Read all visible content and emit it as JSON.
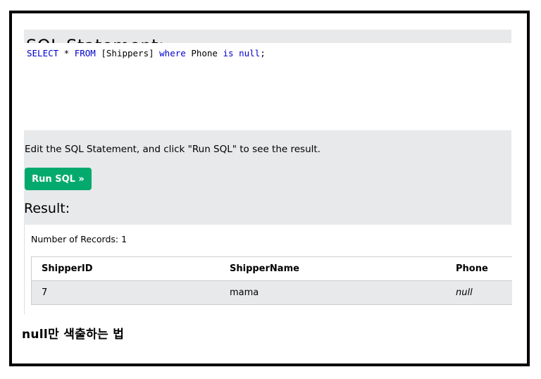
{
  "page": {
    "heading_cut": "SQL Statement:",
    "sql": {
      "select_kw": "SELECT",
      "star": " * ",
      "from_kw": "FROM",
      "table": " [Shippers] ",
      "where_kw": "where",
      "column": " Phone ",
      "is_kw": "is",
      "space": " ",
      "null_kw": "null",
      "end": ";"
    },
    "hint": "Edit the SQL Statement, and click \"Run SQL\" to see the result.",
    "run_button": "Run SQL »",
    "result_heading": "Result:",
    "records_label": "Number of Records: 1",
    "table": {
      "headers": [
        "ShipperID",
        "ShipperName",
        "Phone"
      ],
      "rows": [
        [
          "7",
          "mama",
          "null"
        ]
      ]
    },
    "caption": "null만 색출하는 법"
  },
  "colors": {
    "accent_green": "#04aa6d",
    "panel_gray": "#e7e9eb",
    "sql_keyword": "#0000cd"
  }
}
